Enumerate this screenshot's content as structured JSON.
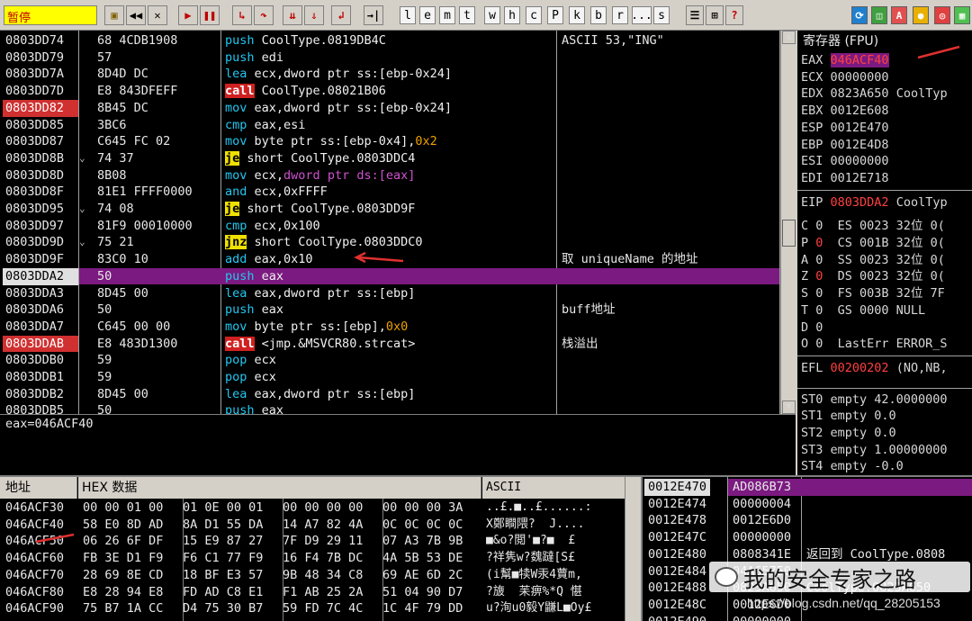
{
  "toolbar": {
    "status": "暂停",
    "letters": [
      "l",
      "e",
      "m",
      "t",
      "w",
      "h",
      "c",
      "P",
      "k",
      "b",
      "r",
      "...",
      "s"
    ]
  },
  "disasm": {
    "rows": [
      {
        "addr": "0803DD74",
        "hex": "68 4CDB1908",
        "op": "push",
        "args": "CoolType.0819DB4C",
        "cmt": "ASCII 53,\"ING\""
      },
      {
        "addr": "0803DD79",
        "hex": "57",
        "op": "push",
        "args": "edi",
        "cmt": ""
      },
      {
        "addr": "0803DD7A",
        "hex": "8D4D DC",
        "op": "lea",
        "args": "ecx,dword ptr ss:[ebp-0x24]",
        "cmt": ""
      },
      {
        "addr": "0803DD7D",
        "hex": "E8 843DFEFF",
        "op": "call",
        "args": "CoolType.08021B06",
        "cmt": ""
      },
      {
        "addr": "0803DD82",
        "hex": "8B45 DC",
        "op": "mov",
        "args": "eax,dword ptr ss:[ebp-0x24]",
        "cmt": "",
        "bp": true
      },
      {
        "addr": "0803DD85",
        "hex": "3BC6",
        "op": "cmp",
        "args": "eax,esi",
        "cmt": ""
      },
      {
        "addr": "0803DD87",
        "hex": "C645 FC 02",
        "op": "mov",
        "args": "byte ptr ss:[ebp-0x4],0x2",
        "cmt": ""
      },
      {
        "addr": "0803DD8B",
        "hex": "74 37",
        "op": "je",
        "args": "short CoolType.0803DDC4",
        "cmt": ""
      },
      {
        "addr": "0803DD8D",
        "hex": "8B08",
        "op": "mov",
        "args": "ecx,dword ptr ds:[eax]",
        "cmt": ""
      },
      {
        "addr": "0803DD8F",
        "hex": "81E1 FFFF0000",
        "op": "and",
        "args": "ecx,0xFFFF",
        "cmt": ""
      },
      {
        "addr": "0803DD95",
        "hex": "74 08",
        "op": "je",
        "args": "short CoolType.0803DD9F",
        "cmt": ""
      },
      {
        "addr": "0803DD97",
        "hex": "81F9 00010000",
        "op": "cmp",
        "args": "ecx,0x100",
        "cmt": ""
      },
      {
        "addr": "0803DD9D",
        "hex": "75 21",
        "op": "jnz",
        "args": "short CoolType.0803DDC0",
        "cmt": ""
      },
      {
        "addr": "0803DD9F",
        "hex": "83C0 10",
        "op": "add",
        "args": "eax,0x10",
        "cmt": "取 uniqueName 的地址"
      },
      {
        "addr": "0803DDA2",
        "hex": "50",
        "op": "push",
        "args": "eax",
        "cmt": "",
        "cur": true
      },
      {
        "addr": "0803DDA3",
        "hex": "8D45 00",
        "op": "lea",
        "args": "eax,dword ptr ss:[ebp]",
        "cmt": ""
      },
      {
        "addr": "0803DDA6",
        "hex": "50",
        "op": "push",
        "args": "eax",
        "cmt": "buff地址"
      },
      {
        "addr": "0803DDA7",
        "hex": "C645 00 00",
        "op": "mov",
        "args": "byte ptr ss:[ebp],0x0",
        "cmt": ""
      },
      {
        "addr": "0803DDAB",
        "hex": "E8 483D1300",
        "op": "call",
        "args": "<jmp.&MSVCR80.strcat>",
        "cmt": "栈溢出",
        "bp": true
      },
      {
        "addr": "0803DDB0",
        "hex": "59",
        "op": "pop",
        "args": "ecx",
        "cmt": ""
      },
      {
        "addr": "0803DDB1",
        "hex": "59",
        "op": "pop",
        "args": "ecx",
        "cmt": ""
      },
      {
        "addr": "0803DDB2",
        "hex": "8D45 00",
        "op": "lea",
        "args": "eax,dword ptr ss:[ebp]",
        "cmt": ""
      },
      {
        "addr": "0803DDB5",
        "hex": "50",
        "op": "push",
        "args": "eax",
        "cmt": ""
      }
    ],
    "info": "eax=046ACF40"
  },
  "registers": {
    "title": "寄存器 (FPU)",
    "gp": [
      {
        "name": "EAX",
        "val": "046ACF40",
        "extra": ""
      },
      {
        "name": "ECX",
        "val": "00000000",
        "extra": ""
      },
      {
        "name": "EDX",
        "val": "0823A650",
        "extra": "CoolTyp"
      },
      {
        "name": "EBX",
        "val": "0012E608",
        "extra": ""
      },
      {
        "name": "ESP",
        "val": "0012E470",
        "extra": ""
      },
      {
        "name": "EBP",
        "val": "0012E4D8",
        "extra": ""
      },
      {
        "name": "ESI",
        "val": "00000000",
        "extra": ""
      },
      {
        "name": "EDI",
        "val": "0012E718",
        "extra": ""
      }
    ],
    "eip": {
      "name": "EIP",
      "val": "0803DDA2",
      "extra": "CoolTyp"
    },
    "flags": [
      "C 0  ES 0023 32位 0(",
      "P 0  CS 001B 32位 0(",
      "A 0  SS 0023 32位 0(",
      "Z 0  DS 0023 32位 0(",
      "S 0  FS 003B 32位 7F",
      "T 0  GS 0000 NULL",
      "D 0",
      "O 0  LastErr ERROR_S"
    ],
    "efl": {
      "name": "EFL",
      "val": "00200202",
      "extra": "(NO,NB,"
    },
    "st": [
      "ST0 empty 42.0000000",
      "ST1 empty 0.0",
      "ST2 empty 0.0",
      "ST3 empty 1.00000000",
      "ST4 empty -0.0"
    ]
  },
  "dump": {
    "headers": {
      "addr": "地址",
      "hex": "HEX 数据",
      "ascii": "ASCII"
    },
    "rows": [
      {
        "addr": "046ACF30",
        "hex": [
          "00 00 01 00",
          "01 0E 00 01",
          "00 00 00 00",
          "00 00 00 3A"
        ],
        "ascii": "..£.■..£......:"
      },
      {
        "addr": "046ACF40",
        "hex": [
          "58 E0 8D AD",
          "8A D1 55 DA",
          "14 A7 82 4A",
          "0C 0C 0C 0C"
        ],
        "ascii": "X鄭瞷隈?  J...."
      },
      {
        "addr": "046ACF50",
        "hex": [
          "06 26 6F DF",
          "15 E9 87 27",
          "7F D9 29 11",
          "07 A3 7B 9B"
        ],
        "ascii": "■&o?閲'■?■  £"
      },
      {
        "addr": "046ACF60",
        "hex": [
          "FB 3E D1 F9",
          "F6 C1 77 F9",
          "16 F4 7B DC",
          "4A 5B 53 DE"
        ],
        "ascii": "?祥隽w?魏躂[S£"
      },
      {
        "addr": "046ACF70",
        "hex": [
          "28 69 8E CD",
          "18 BF E3 57",
          "9B 48 34 C8",
          "69 AE 6D 2C"
        ],
        "ascii": "(i幫■犊W汞4蕒m,"
      },
      {
        "addr": "046ACF80",
        "hex": [
          "E8 28 94 E8",
          "FD AD C8 E1",
          "F1 AB 25 2A",
          "51 04 90 D7"
        ],
        "ascii": "?旇  苿痹%*Q 愖"
      },
      {
        "addr": "046ACF90",
        "hex": [
          "75 B7 1A CC",
          "D4 75 30 B7",
          "59 FD 7C 4C",
          "1C 4F 79 DD"
        ],
        "ascii": "u?洵u0毅Y鼸L■Oy£"
      }
    ]
  },
  "stack": {
    "rows": [
      {
        "addr": "0012E470",
        "val": "AD086B73",
        "cmt": "",
        "sel": true
      },
      {
        "addr": "0012E474",
        "val": "00000004",
        "cmt": ""
      },
      {
        "addr": "0012E478",
        "val": "0012E6D0",
        "cmt": ""
      },
      {
        "addr": "0012E47C",
        "val": "00000000",
        "cmt": ""
      },
      {
        "addr": "0012E480",
        "val": "0808341E",
        "cmt": "返回到 CoolType.0808"
      },
      {
        "addr": "0012E484",
        "val": "04A65750",
        "cmt": ""
      },
      {
        "addr": "0012E488",
        "val": "0823A650",
        "cmt": "CoolType.0823A650"
      },
      {
        "addr": "0012E48C",
        "val": "0012E6D0",
        "cmt": ""
      },
      {
        "addr": "0012E490",
        "val": "00000000",
        "cmt": ""
      }
    ],
    "watermark": "我的安全专家之路",
    "url": "https://blog.csdn.net/qq_28205153"
  }
}
